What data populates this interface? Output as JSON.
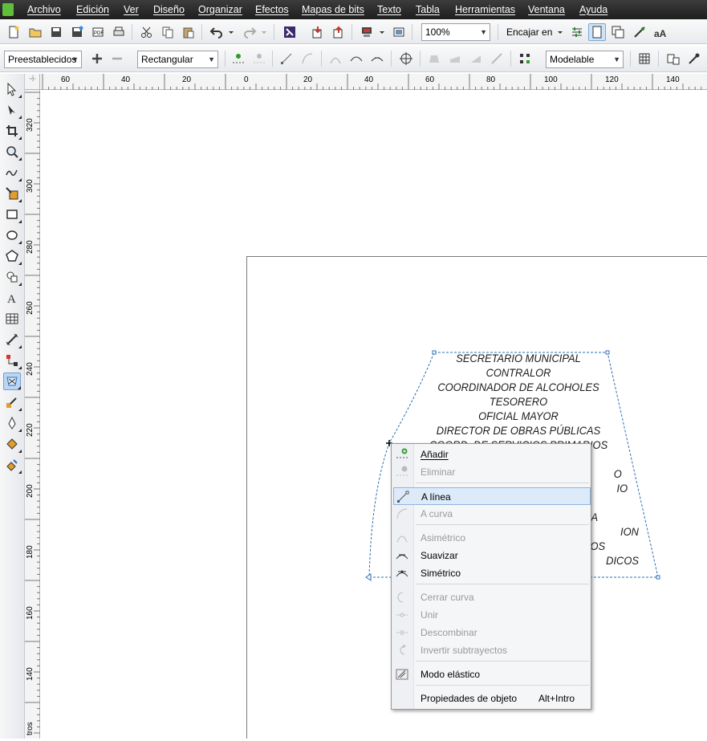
{
  "menubar": {
    "items": [
      "Archivo",
      "Edición",
      "Ver",
      "Diseño",
      "Organizar",
      "Efectos",
      "Mapas de bits",
      "Texto",
      "Tabla",
      "Herramientas",
      "Ventana",
      "Ayuda"
    ]
  },
  "toolbar1": {
    "zoom_value": "100%",
    "snap_label": "Encajar en"
  },
  "toolbar2": {
    "presets_value": "Preestablecidos",
    "node_type_value": "Rectangular",
    "elastic_value": "Modelable"
  },
  "ruler_top": {
    "labels": [
      "60",
      "40",
      "20",
      "0",
      "20",
      "40",
      "60",
      "80",
      "100",
      "120",
      "140"
    ]
  },
  "ruler_left": {
    "labels": [
      "320",
      "300",
      "280",
      "260",
      "240",
      "220",
      "200",
      "180",
      "160",
      "140"
    ],
    "unit": "tros"
  },
  "document": {
    "text_lines": [
      "SECRETARIO MUNICIPAL",
      "CONTRALOR",
      "COORDINADOR DE ALCOHOLES",
      "TESORERO",
      "OFICIAL MAYOR",
      "DIRECTOR DE OBRAS PÚBLICAS",
      "COORD. DE SERVICIOS PRIMARIOS",
      "",
      "O",
      "IO",
      "",
      "CO                                   DADANA",
      "ION",
      "COO                                   LIGIOSOS",
      "DICOS"
    ]
  },
  "context_menu": {
    "items": [
      {
        "label": "Añadir",
        "icon": "add-node-icon",
        "enabled": true,
        "highlighted": false
      },
      {
        "label": "Eliminar",
        "icon": "delete-node-icon",
        "enabled": false,
        "highlighted": false
      },
      {
        "label": "A línea",
        "icon": "to-line-icon",
        "enabled": true,
        "highlighted": true
      },
      {
        "label": "A curva",
        "icon": "to-curve-icon",
        "enabled": false,
        "highlighted": false
      },
      {
        "label": "Asimétrico",
        "icon": "cusp-node-icon",
        "enabled": false,
        "highlighted": false
      },
      {
        "label": "Suavizar",
        "icon": "smooth-node-icon",
        "enabled": true,
        "highlighted": false
      },
      {
        "label": "Simétrico",
        "icon": "symmetric-node-icon",
        "enabled": true,
        "highlighted": false
      },
      {
        "label": "Cerrar curva",
        "icon": "close-curve-icon",
        "enabled": false,
        "highlighted": false
      },
      {
        "label": "Unir",
        "icon": "join-nodes-icon",
        "enabled": false,
        "highlighted": false
      },
      {
        "label": "Descombinar",
        "icon": "break-apart-icon",
        "enabled": false,
        "highlighted": false
      },
      {
        "label": "Invertir subtrayectos",
        "icon": "reverse-subpaths-icon",
        "enabled": false,
        "highlighted": false
      },
      {
        "label": "Modo elástico",
        "icon": "elastic-mode-icon",
        "enabled": true,
        "highlighted": false
      },
      {
        "label": "Propiedades de objeto",
        "shortcut": "Alt+Intro",
        "enabled": true,
        "highlighted": false
      }
    ]
  },
  "colors": {
    "menubar_bg": "#2a2a2a",
    "highlight_bg": "#dceaf9",
    "selection_box": "#2d6fb5",
    "disabled_text": "#9a9a9a"
  }
}
